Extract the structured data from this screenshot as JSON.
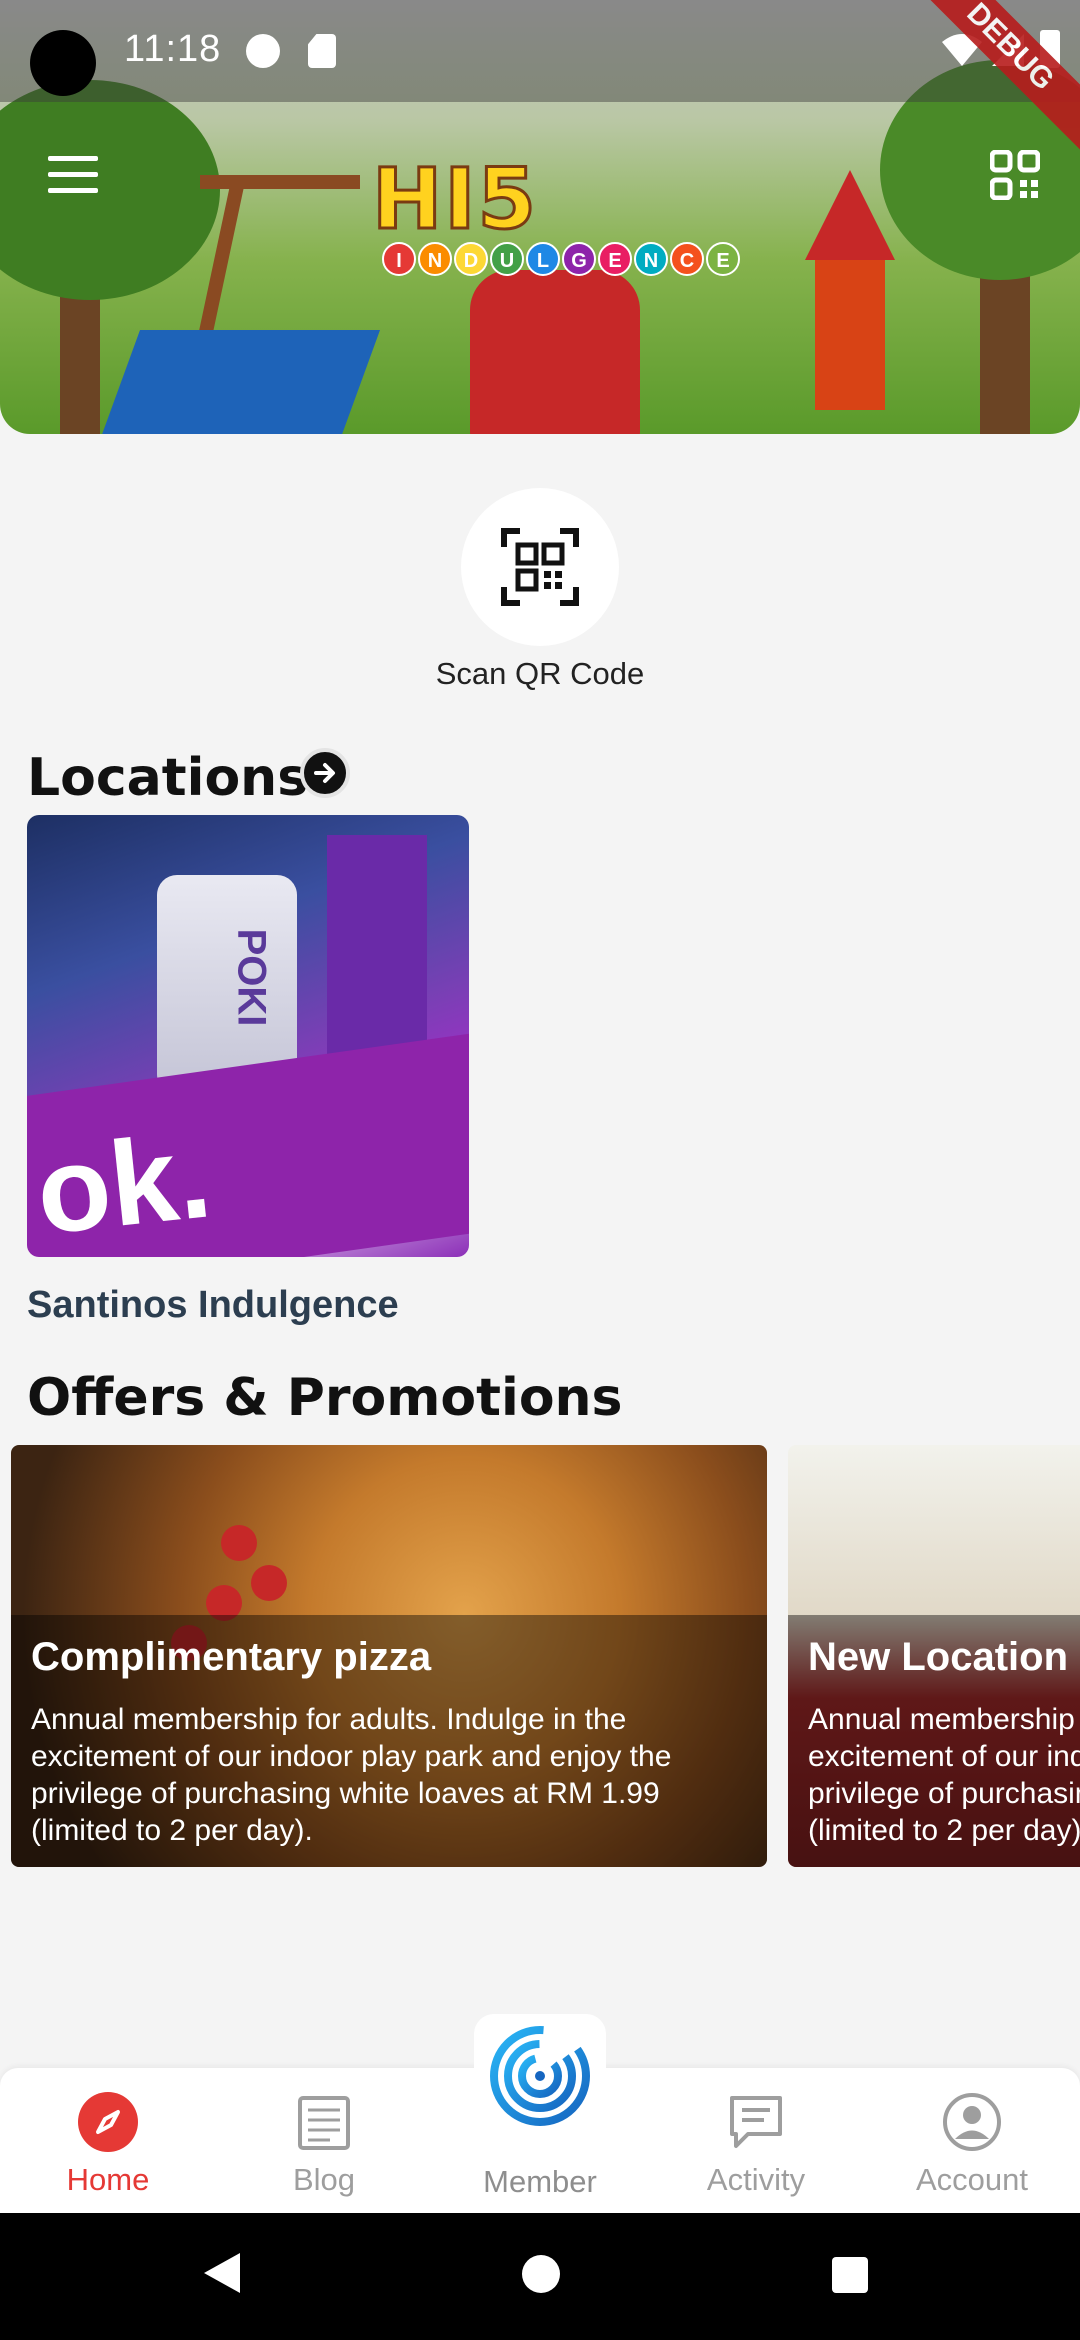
{
  "status_bar": {
    "time": "11:18",
    "debug_label": "DEBUG"
  },
  "header": {
    "logo_main": "HI5",
    "logo_sub": [
      "I",
      "N",
      "D",
      "U",
      "L",
      "G",
      "E",
      "N",
      "C",
      "E"
    ],
    "logo_sub_colors": [
      "#e53935",
      "#fb8c00",
      "#fdd835",
      "#43a047",
      "#1e88e5",
      "#8e24aa",
      "#e91e63",
      "#00acc1",
      "#f4511e",
      "#7cb342"
    ]
  },
  "scan": {
    "label": "Scan QR Code"
  },
  "locations": {
    "title": "Locations",
    "items": [
      {
        "name": "Santinos Indulgence",
        "image_text": "POKI"
      }
    ]
  },
  "offers": {
    "title": "Offers & Promotions",
    "items": [
      {
        "title": "Complimentary pizza",
        "description": "Annual membership for adults. Indulge in the excitement of our indoor play park and enjoy the privilege of purchasing white loaves at RM 1.99 (limited to 2 per day)."
      },
      {
        "title": "New Location",
        "description": "Annual membership for adults. Indulge in the excitement of our indoor play park and enjoy the privilege of purchasing white loaves at RM 1.99 (limited to 2 per day)."
      }
    ]
  },
  "bottom_nav": {
    "items": [
      {
        "label": "Home",
        "icon": "compass-icon"
      },
      {
        "label": "Blog",
        "icon": "document-icon"
      },
      {
        "label": "Member",
        "icon": "fingerprint-icon"
      },
      {
        "label": "Activity",
        "icon": "chat-icon"
      },
      {
        "label": "Account",
        "icon": "user-circle-icon"
      }
    ],
    "active": "Home",
    "active_color": "#e53935",
    "inactive_color": "#9e9e9e"
  }
}
